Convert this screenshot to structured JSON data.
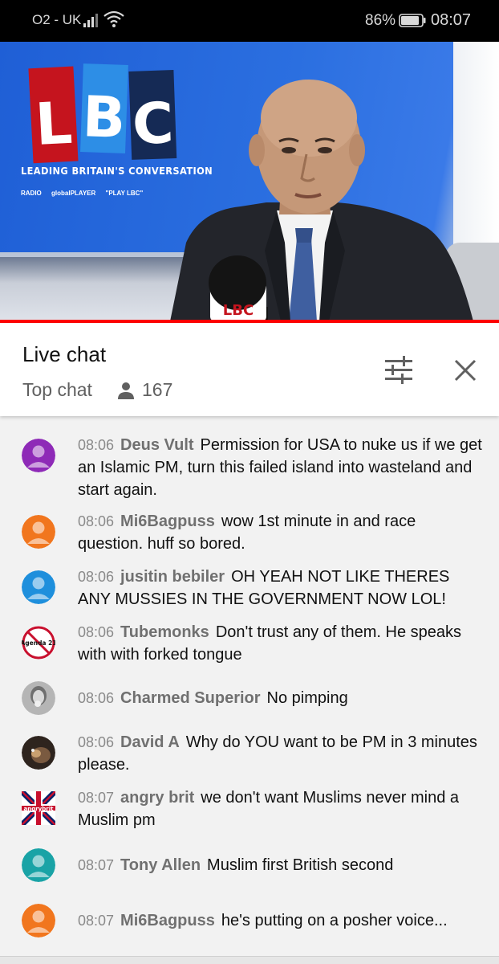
{
  "status_bar": {
    "carrier": "O2 - UK",
    "battery_percent": "86%",
    "time": "08:07"
  },
  "video": {
    "logo_letters": [
      "L",
      "B",
      "C"
    ],
    "tagline": "LEADING BRITAIN'S CONVERSATION",
    "platforms": [
      "RADIO",
      "globalPLAYER",
      "\"PLAY LBC\""
    ],
    "mic_label": "LBC",
    "progress_fraction": 1.0
  },
  "chat": {
    "title": "Live chat",
    "mode": "Top chat",
    "viewer_count": "167",
    "icons": {
      "filter": "tune-icon",
      "close": "close-icon",
      "viewers": "person-icon"
    }
  },
  "messages": [
    {
      "time": "08:06",
      "author": "Deus Vult",
      "text": "Permission for USA to nuke us if we get an Islamic PM, turn this failed island into wasteland and start again.",
      "avatar_color": "#8e2ab7",
      "avatar": "default"
    },
    {
      "time": "08:06",
      "author": "Mi6Bagpuss",
      "text": "wow 1st minute in and race question. huff so bored.",
      "avatar_color": "#f1761e",
      "avatar": "default"
    },
    {
      "time": "08:06",
      "author": "jusitin bebiler",
      "text": "OH YEAH NOT LIKE THERES ANY MUSSIES IN THE GOVERNMENT NOW LOL!",
      "avatar_color": "#1e8fdc",
      "avatar": "default"
    },
    {
      "time": "08:06",
      "author": "Tubemonks",
      "text": "Don't trust any of them. He speaks with with forked tongue",
      "avatar_color": "#ffffff",
      "avatar": "agenda21",
      "avatar_text": "Agenda 21"
    },
    {
      "time": "08:06",
      "author": "Charmed Superior",
      "text": "No pimping",
      "avatar_color": "#9a9a9a",
      "avatar": "photo-face"
    },
    {
      "time": "08:06",
      "author": "David A",
      "text": "Why do YOU want to be PM in 3 minutes please.",
      "avatar_color": "#4a3a30",
      "avatar": "photo-cat"
    },
    {
      "time": "08:07",
      "author": "angry brit",
      "text": "we don't want Muslims never mind a Muslim pm",
      "avatar_color": "#c8102e",
      "avatar": "union-flag",
      "avatar_text": "angrybrit"
    },
    {
      "time": "08:07",
      "author": "Tony Allen",
      "text": "Muslim first British second",
      "avatar_color": "#19a3a6",
      "avatar": "default"
    },
    {
      "time": "08:07",
      "author": "Mi6Bagpuss",
      "text": "he's putting on a posher voice...",
      "avatar_color": "#f1761e",
      "avatar": "default"
    }
  ]
}
